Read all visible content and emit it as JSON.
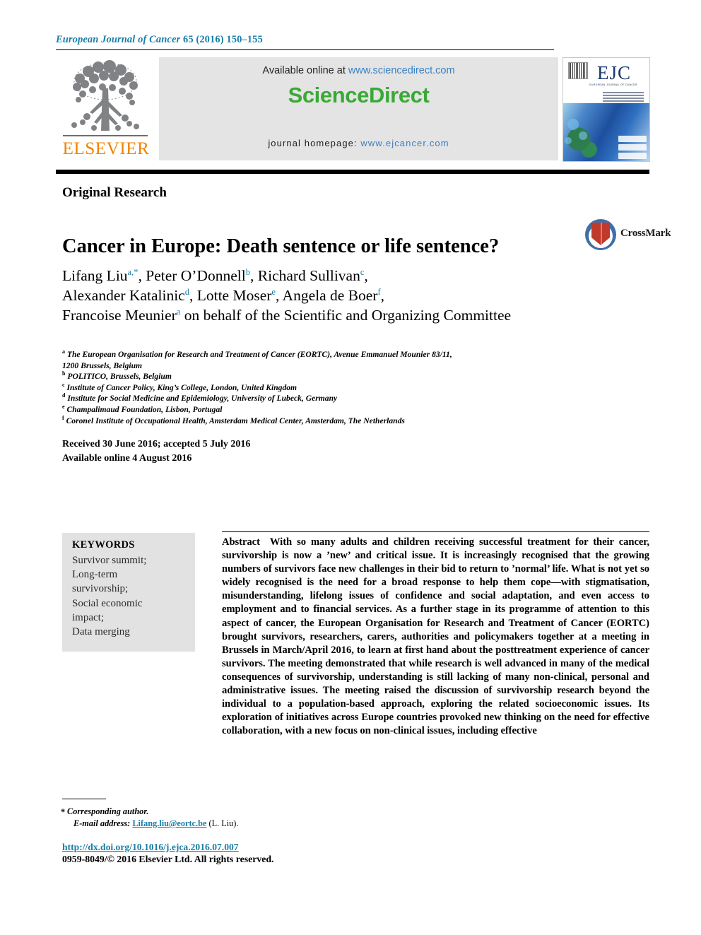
{
  "header": {
    "journal_name": "European Journal of Cancer",
    "volume_pages": "65 (2016) 150–155"
  },
  "masthead": {
    "publisher_name": "ELSEVIER",
    "publisher_logo_alt": "elsevier-tree-logo",
    "available_online_prefix": "Available online at ",
    "sciencedirect_url": "www.sciencedirect.com",
    "sciencedirect_logo": "ScienceDirect",
    "journal_homepage_prefix": "journal homepage: ",
    "journal_homepage_url": "www.ejcancer.com",
    "cover": {
      "title": "EJC",
      "subtitle": "EUROPEAN JOURNAL OF CANCER",
      "alt": "ejc-journal-cover"
    }
  },
  "article": {
    "type": "Original Research",
    "title": "Cancer in Europe: Death sentence or life sentence?",
    "crossmark_label": "CrossMark"
  },
  "authors": {
    "lines": [
      {
        "parts": [
          {
            "name": "Lifang Liu",
            "sup": "a,*"
          },
          {
            "name": "Peter O’Donnell",
            "sup": "b"
          },
          {
            "name": "Richard Sullivan",
            "sup": "c"
          }
        ],
        "trailing": ","
      },
      {
        "parts": [
          {
            "name": "Alexander Katalinic",
            "sup": "d"
          },
          {
            "name": "Lotte Moser",
            "sup": "e"
          },
          {
            "name": "Angela de Boer",
            "sup": "f"
          }
        ],
        "trailing": ","
      },
      {
        "parts": [
          {
            "name": "Francoise Meunier",
            "sup": "a"
          }
        ],
        "trailing": " on behalf of the Scientific and Organizing Committee"
      }
    ]
  },
  "affiliations": [
    {
      "marker": "a",
      "text": "The European Organisation for Research and Treatment of Cancer (EORTC), Avenue Emmanuel Mounier 83/11,"
    },
    {
      "marker": "",
      "text": "1200 Brussels, Belgium"
    },
    {
      "marker": "b",
      "text": "POLITICO, Brussels, Belgium"
    },
    {
      "marker": "c",
      "text": "Institute of Cancer Policy, King’s College, London, United Kingdom"
    },
    {
      "marker": "d",
      "text": "Institute for Social Medicine and Epidemiology, University of Lubeck, Germany"
    },
    {
      "marker": "e",
      "text": "Champalimaud Foundation, Lisbon, Portugal"
    },
    {
      "marker": "f",
      "text": "Coronel Institute of Occupational Health, Amsterdam Medical Center, Amsterdam, The Netherlands"
    }
  ],
  "history": {
    "received_accepted": "Received 30 June 2016; accepted 5 July 2016",
    "available_online": "Available online 4 August 2016"
  },
  "keywords": {
    "heading": "KEYWORDS",
    "items": [
      "Survivor summit;",
      "Long-term",
      "survivorship;",
      "Social economic",
      "impact;",
      "Data merging"
    ]
  },
  "abstract": {
    "label": "Abstract",
    "text": "With so many adults and children receiving successful treatment for their cancer, survivorship is now a ’new’ and critical issue. It is increasingly recognised that the growing numbers of survivors face new challenges in their bid to return to ’normal’ life. What is not yet so widely recognised is the need for a broad response to help them cope—with stigmatisation, misunderstanding, lifelong issues of confidence and social adaptation, and even access to employment and to financial services. As a further stage in its programme of attention to this aspect of cancer, the European Organisation for Research and Treatment of Cancer (EORTC) brought survivors, researchers, carers, authorities and policymakers together at a meeting in Brussels in March/April 2016, to learn at first hand about the posttreatment experience of cancer survivors. The meeting demonstrated that while research is well advanced in many of the medical consequences of survivorship, understanding is still lacking of many non-clinical, personal and administrative issues. The meeting raised the discussion of survivorship research beyond the individual to a population-based approach, exploring the related socioeconomic issues. Its exploration of initiatives across Europe countries provoked new thinking on the need for effective collaboration, with a new focus on non-clinical issues, including effective"
  },
  "footer": {
    "corresponding_marker": "*",
    "corresponding_label": "Corresponding author.",
    "email_label": "E-mail address:",
    "email_address": "Lifang.liu@eortc.be",
    "email_owner": "(L. Liu).",
    "doi_url": "http://dx.doi.org/10.1016/j.ejca.2016.07.007",
    "copyright": "0959-8049/© 2016 Elsevier Ltd. All rights reserved."
  },
  "colors": {
    "journal_blue": "#1a7fa8",
    "link_blue": "#3a7fc1",
    "sciencedirect_green": "#3aa935",
    "elsevier_orange": "#ef8200",
    "keyword_bg": "#e2e2e2",
    "banner_bg": "#e4e4e4"
  }
}
